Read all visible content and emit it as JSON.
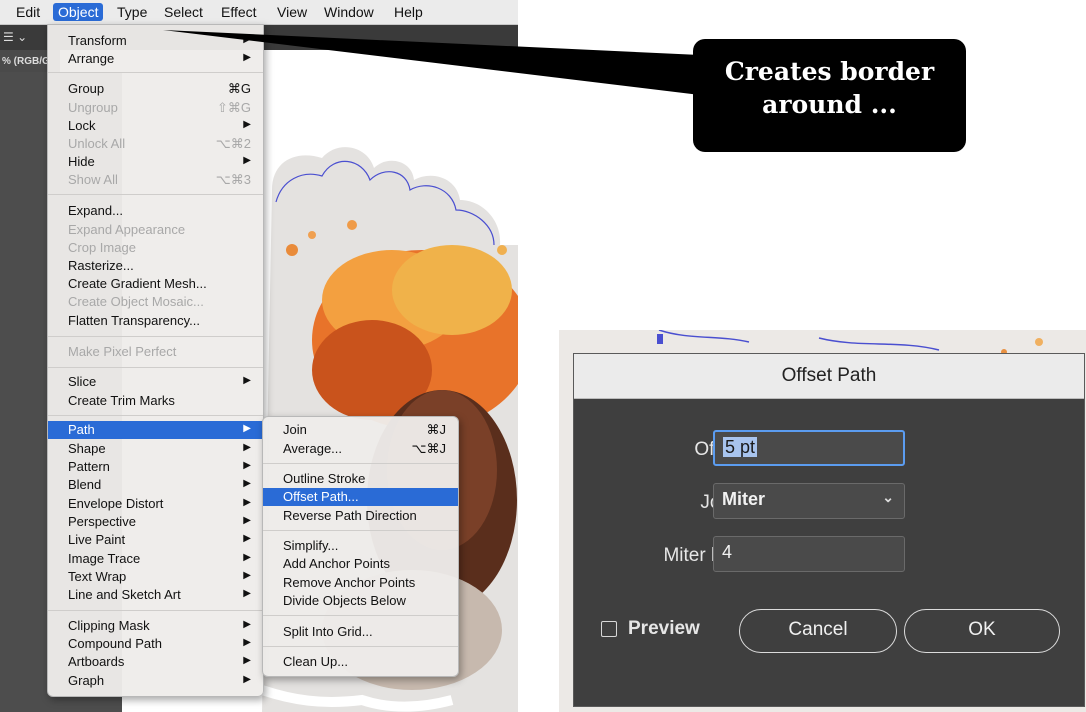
{
  "menubar": {
    "items": [
      "Edit",
      "Object",
      "Type",
      "Select",
      "Effect",
      "View",
      "Window",
      "Help"
    ],
    "active": "Object"
  },
  "document": {
    "tab_label": "% (RGB/G"
  },
  "object_menu": {
    "items": [
      {
        "label": "Transform",
        "shortcut": "",
        "arrow": true,
        "disabled": false
      },
      {
        "label": "Arrange",
        "shortcut": "",
        "arrow": true,
        "disabled": false
      },
      {
        "label": "Group",
        "shortcut": "⌘G",
        "arrow": false,
        "disabled": false
      },
      {
        "label": "Ungroup",
        "shortcut": "⇧⌘G",
        "arrow": false,
        "disabled": true
      },
      {
        "label": "Lock",
        "shortcut": "",
        "arrow": true,
        "disabled": false
      },
      {
        "label": "Unlock All",
        "shortcut": "⌥⌘2",
        "arrow": false,
        "disabled": true
      },
      {
        "label": "Hide",
        "shortcut": "",
        "arrow": true,
        "disabled": false
      },
      {
        "label": "Show All",
        "shortcut": "⌥⌘3",
        "arrow": false,
        "disabled": true
      },
      {
        "label": "Expand...",
        "shortcut": "",
        "arrow": false,
        "disabled": false
      },
      {
        "label": "Expand Appearance",
        "shortcut": "",
        "arrow": false,
        "disabled": true
      },
      {
        "label": "Crop Image",
        "shortcut": "",
        "arrow": false,
        "disabled": true
      },
      {
        "label": "Rasterize...",
        "shortcut": "",
        "arrow": false,
        "disabled": false
      },
      {
        "label": "Create Gradient Mesh...",
        "shortcut": "",
        "arrow": false,
        "disabled": false
      },
      {
        "label": "Create Object Mosaic...",
        "shortcut": "",
        "arrow": false,
        "disabled": true
      },
      {
        "label": "Flatten Transparency...",
        "shortcut": "",
        "arrow": false,
        "disabled": false
      },
      {
        "label": "Make Pixel Perfect",
        "shortcut": "",
        "arrow": false,
        "disabled": true
      },
      {
        "label": "Slice",
        "shortcut": "",
        "arrow": true,
        "disabled": false
      },
      {
        "label": "Create Trim Marks",
        "shortcut": "",
        "arrow": false,
        "disabled": false
      },
      {
        "label": "Path",
        "shortcut": "",
        "arrow": true,
        "disabled": false,
        "highlighted": true
      },
      {
        "label": "Shape",
        "shortcut": "",
        "arrow": true,
        "disabled": false
      },
      {
        "label": "Pattern",
        "shortcut": "",
        "arrow": true,
        "disabled": false
      },
      {
        "label": "Blend",
        "shortcut": "",
        "arrow": true,
        "disabled": false
      },
      {
        "label": "Envelope Distort",
        "shortcut": "",
        "arrow": true,
        "disabled": false
      },
      {
        "label": "Perspective",
        "shortcut": "",
        "arrow": true,
        "disabled": false
      },
      {
        "label": "Live Paint",
        "shortcut": "",
        "arrow": true,
        "disabled": false
      },
      {
        "label": "Image Trace",
        "shortcut": "",
        "arrow": true,
        "disabled": false
      },
      {
        "label": "Text Wrap",
        "shortcut": "",
        "arrow": true,
        "disabled": false
      },
      {
        "label": "Line and Sketch Art",
        "shortcut": "",
        "arrow": true,
        "disabled": false
      },
      {
        "label": "Clipping Mask",
        "shortcut": "",
        "arrow": true,
        "disabled": false
      },
      {
        "label": "Compound Path",
        "shortcut": "",
        "arrow": true,
        "disabled": false
      },
      {
        "label": "Artboards",
        "shortcut": "",
        "arrow": true,
        "disabled": false
      },
      {
        "label": "Graph",
        "shortcut": "",
        "arrow": true,
        "disabled": false
      }
    ]
  },
  "path_submenu": {
    "items": [
      {
        "label": "Join",
        "shortcut": "⌘J"
      },
      {
        "label": "Average...",
        "shortcut": "⌥⌘J"
      },
      {
        "label": "Outline Stroke",
        "shortcut": ""
      },
      {
        "label": "Offset Path...",
        "shortcut": "",
        "highlighted": true
      },
      {
        "label": "Reverse Path Direction",
        "shortcut": ""
      },
      {
        "label": "Simplify...",
        "shortcut": ""
      },
      {
        "label": "Add Anchor Points",
        "shortcut": ""
      },
      {
        "label": "Remove Anchor Points",
        "shortcut": ""
      },
      {
        "label": "Divide Objects Below",
        "shortcut": ""
      },
      {
        "label": "Split Into Grid...",
        "shortcut": ""
      },
      {
        "label": "Clean Up...",
        "shortcut": ""
      }
    ]
  },
  "callout": {
    "text": "Creates border around ..."
  },
  "dialog": {
    "title": "Offset Path",
    "offset_label": "Offset:",
    "offset_value": "5 pt",
    "joins_label": "Joins:",
    "joins_value": "Miter",
    "miter_label": "Miter limit:",
    "miter_value": "4",
    "preview_label": "Preview",
    "preview_checked": false,
    "cancel_label": "Cancel",
    "ok_label": "OK"
  },
  "colors": {
    "menu_highlight": "#2a6bd6",
    "dialog_bg": "#3f3f3f",
    "path_stroke": "#4a4fd0"
  }
}
